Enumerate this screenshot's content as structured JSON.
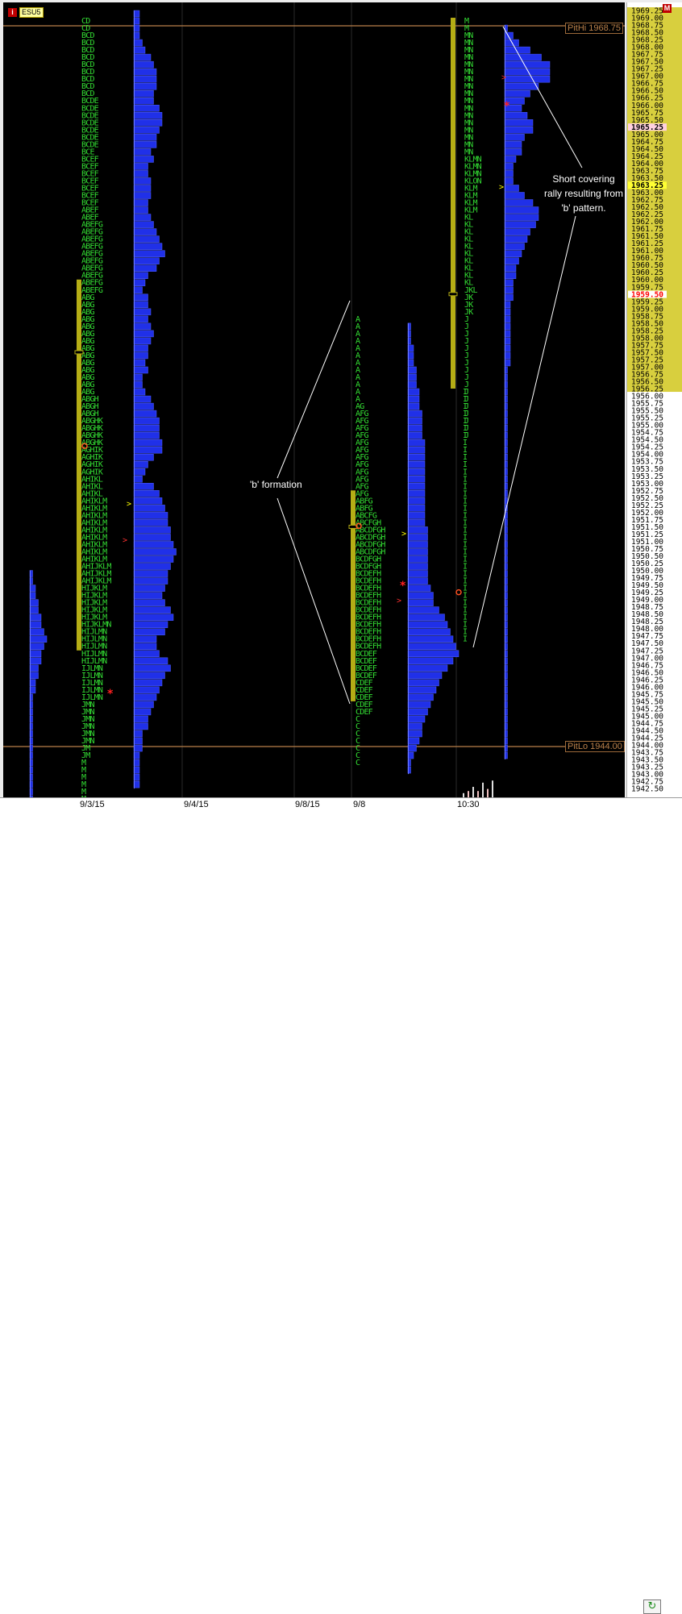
{
  "header": {
    "symbol": "ESU5",
    "info_icon": "i",
    "maximize_icon": "M"
  },
  "pit_levels": {
    "pithi_label": "PitHi 1968.75",
    "pithi": 1968.75,
    "pitlo_label": "PitLo 1944.00",
    "pitlo": 1944.0
  },
  "annotations": {
    "short_covering": "Short covering rally resulting from 'b' pattern.",
    "b_formation": "'b' formation"
  },
  "x_labels": [
    "9/3/15",
    "9/4/15",
    "9/8/15",
    "9/8",
    "10:30"
  ],
  "refresh_icon": "refresh-icon",
  "chart_data": {
    "type": "market-profile",
    "instrument": "ESU5",
    "ylim": [
      1942.5,
      1969.25
    ],
    "tick_size": 0.25,
    "price_label_step": 0.25,
    "highlight_labels": [
      {
        "price": 1965.25,
        "color": "#ffd0e0",
        "text_color": "#000000"
      },
      {
        "price": 1963.25,
        "color": "#ffff33",
        "text_color": "#000000"
      },
      {
        "price": 1959.5,
        "color": "#ffffff",
        "text_color": "#ff0000"
      }
    ],
    "value_area_shading": {
      "from": 1956.25,
      "to": 1969.25,
      "color": "#d8cf3e"
    },
    "colors": {
      "letters": "#33dd33",
      "histogram": "#2030e8",
      "value_area_bar": "#b5ad15",
      "vpoc": "#ff5020",
      "pit": "#b9804a"
    },
    "profiles": [
      {
        "id": "p1",
        "session": "9/3/15",
        "letters_top": 1969.0,
        "rows": [
          "CD",
          "CD",
          "BCD",
          "BCD",
          "BCD",
          "BCD",
          "BCD",
          "BCD",
          "BCD",
          "BCD",
          "BCD",
          "BCDE",
          "BCDE",
          "BCDE",
          "BCDE",
          "BCDE",
          "BCDE",
          "BCDE",
          "BCE",
          "BCEF",
          "BCEF",
          "BCEF",
          "BCEF",
          "BCEF",
          "BCEF",
          "BCEF",
          "ABEF",
          "ABEF",
          "ABEFG",
          "ABEFG",
          "ABEFG",
          "ABEFG",
          "ABEFG",
          "ABEFG",
          "ABEFG",
          "ABEFG",
          "ABEFG",
          "ABEFG",
          "ABG",
          "ABG",
          "ABG",
          "ABG",
          "ABG",
          "ABG",
          "ABG",
          "ABG",
          "ABG",
          "ABG",
          "ABG",
          "ABG",
          "ABG",
          "ABG",
          "ABGH",
          "ABGH",
          "ABGH",
          "ABGHK",
          "ABGHK",
          "ABGHK",
          "ABGHK",
          "AGHIK",
          "AGHIK",
          "AGHIK",
          "AGHIK",
          "AHIKL",
          "AHIKL",
          "AHIKL",
          "AHIKLM",
          "AHIKLM",
          "AHIKLM",
          "AHIKLM",
          "AHIKLM",
          "AHIKLM",
          "AHIKLM",
          "AHIKLM",
          "AHIKLM",
          "AHIJKLM",
          "AHIJKLM",
          "AHIJKLM",
          "HIJKLM",
          "HIJKLM",
          "HIJKLM",
          "HIJKLM",
          "HIJKLM",
          "HIJKLMN",
          "HIJLMN",
          "HIJLMN",
          "HIJLMN",
          "HIJLMN",
          "HIJLMN",
          "IJLMN",
          "IJLMN",
          "IJLMN",
          "IJLMN",
          "IJLMN",
          "JMN",
          "JMN",
          "JMN",
          "JMN",
          "JMN",
          "JMN",
          "JM",
          "JM",
          "M",
          "M",
          "M",
          "M",
          "M",
          "M",
          "M",
          "M",
          "M",
          "M",
          "M"
        ],
        "value_area": [
          1947.25,
          1960.0
        ],
        "poc": 1957.5,
        "open": 1954.25
      },
      {
        "id": "p2",
        "session": "9/8/15",
        "letters_top": 1958.75,
        "rows": [
          "A",
          "A",
          "A",
          "A",
          "A",
          "A",
          "A",
          "A",
          "A",
          "A",
          "A",
          "A",
          "AG",
          "AFG",
          "AFG",
          "AFG",
          "AFG",
          "AFG",
          "AFG",
          "AFG",
          "AFG",
          "AFG",
          "AFG",
          "AFG",
          "AFG",
          "ABFG",
          "ABFG",
          "ABCFG",
          "ABCFGH",
          "ABCDFGH",
          "ABCDFGH",
          "ABCDFGH",
          "ABCDFGH",
          "BCDFGH",
          "BCDFGH",
          "BCDEFH",
          "BCDEFH",
          "BCDEFH",
          "BCDEFH",
          "BCDEFH",
          "BCDEFH",
          "BCDEFH",
          "BCDEFH",
          "BCDEFH",
          "BCDEFH",
          "BCDEFH",
          "BCDEF",
          "BCDEF",
          "BCDEF",
          "BCDEF",
          "CDEF",
          "CDEF",
          "CDEF",
          "CDEF",
          "CDEF",
          "C",
          "C",
          "C",
          "C",
          "C",
          "C",
          "C"
        ],
        "value_area": [
          1945.5,
          1952.75
        ],
        "poc": 1951.5,
        "open": 1951.5
      },
      {
        "id": "p3",
        "session": "9/8 10:30",
        "rows_top": 1969.0,
        "value_area": [
          1956.25,
          1969.0
        ],
        "poc": 1959.5,
        "open": 1949.25
      }
    ],
    "histograms": [
      {
        "id": "h1",
        "top": 1969.25,
        "values": [
          2,
          2,
          2,
          2,
          3,
          4,
          6,
          7,
          8,
          8,
          8,
          7,
          7,
          9,
          10,
          10,
          9,
          8,
          8,
          6,
          7,
          5,
          5,
          6,
          6,
          6,
          5,
          5,
          6,
          7,
          8,
          9,
          10,
          11,
          9,
          8,
          5,
          4,
          3,
          5,
          5,
          6,
          5,
          6,
          7,
          6,
          5,
          5,
          4,
          5,
          3,
          3,
          4,
          6,
          7,
          8,
          9,
          9,
          9,
          10,
          10,
          7,
          5,
          4,
          3,
          7,
          9,
          10,
          11,
          12,
          12,
          13,
          13,
          14,
          15,
          14,
          13,
          12,
          12,
          11,
          10,
          11,
          13,
          14,
          12,
          11,
          8,
          8,
          9,
          12,
          13,
          11,
          10,
          9,
          8,
          7,
          6,
          5,
          5,
          3,
          3,
          3,
          2,
          2,
          2,
          2,
          2
        ]
      },
      {
        "id": "h2",
        "top": 1958.5,
        "values": [
          1,
          1,
          1,
          2,
          2,
          2,
          3,
          3,
          3,
          4,
          4,
          4,
          5,
          5,
          5,
          5,
          6,
          6,
          6,
          6,
          6,
          6,
          6,
          6,
          6,
          6,
          6,
          6,
          7,
          7,
          7,
          7,
          7,
          7,
          7,
          7,
          8,
          9,
          9,
          11,
          13,
          14,
          15,
          16,
          17,
          18,
          16,
          14,
          12,
          11,
          10,
          9,
          8,
          7,
          6,
          5,
          5,
          4,
          3,
          2,
          1,
          1
        ]
      },
      {
        "id": "h3",
        "top": 1968.75,
        "values": [
          1,
          3,
          5,
          9,
          13,
          16,
          16,
          16,
          12,
          9,
          7,
          6,
          8,
          10,
          10,
          7,
          6,
          6,
          4,
          3,
          3,
          3,
          5,
          7,
          10,
          12,
          12,
          11,
          9,
          8,
          7,
          6,
          5,
          4,
          4,
          3,
          3,
          3,
          2,
          2,
          2,
          2,
          2,
          2,
          2,
          2,
          2,
          1,
          1,
          1,
          1,
          1,
          1,
          1,
          1,
          1,
          1,
          1,
          1,
          1,
          1,
          1,
          1,
          1,
          1,
          1,
          1,
          1,
          1,
          1,
          1,
          1,
          1,
          1,
          1,
          1,
          1,
          1,
          1,
          1,
          1,
          1,
          1,
          1,
          1,
          1,
          1,
          1,
          1,
          1,
          1,
          1,
          1,
          1,
          1,
          1,
          1,
          1,
          1,
          1,
          1
        ]
      },
      {
        "id": "h0",
        "top": 1950.0,
        "values": [
          1,
          1,
          2,
          2,
          3,
          3,
          4,
          4,
          5,
          6,
          5,
          4,
          4,
          3,
          3,
          2,
          2,
          1,
          1,
          1,
          1,
          1,
          1,
          1,
          1,
          1,
          1,
          1,
          1,
          1,
          1,
          1
        ]
      }
    ],
    "volume_bars": [
      2,
      3,
      5,
      3,
      7,
      4,
      8
    ]
  }
}
